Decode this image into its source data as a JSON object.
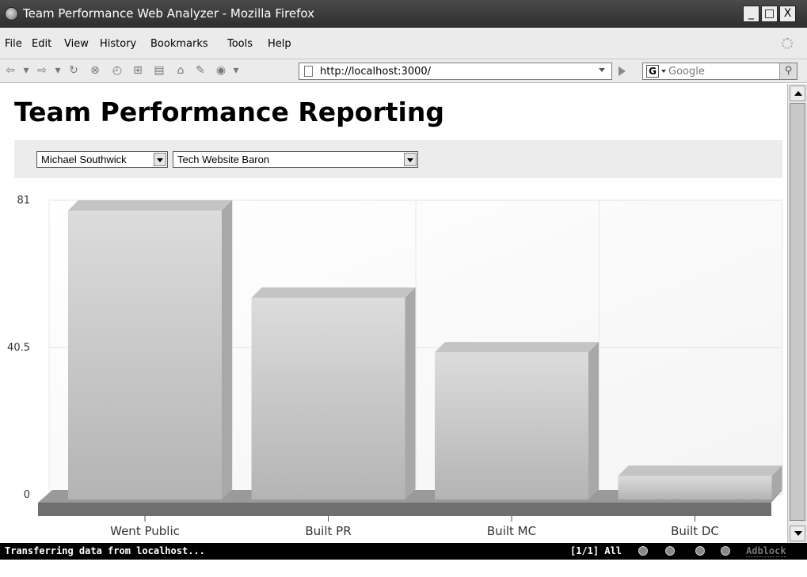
{
  "window": {
    "title": "Team Performance Web Analyzer - Mozilla Firefox",
    "min_label": "_",
    "max_label": "□",
    "close_label": "X"
  },
  "menu": {
    "items": [
      "File",
      "Edit",
      "View",
      "History",
      "Bookmarks",
      "Tools",
      "Help"
    ]
  },
  "toolbar": {
    "url": "http://localhost:3000/",
    "search_placeholder": "Google",
    "search_engine_letter": "G"
  },
  "page": {
    "title": "Team Performance Reporting",
    "user_select": "Michael Southwick",
    "project_select": "Tech Website Baron"
  },
  "chart_data": {
    "type": "bar",
    "style": "3d",
    "categories": [
      "Went Public",
      "Built PR",
      "Built MC",
      "Built DC"
    ],
    "values": [
      81,
      57,
      42,
      8
    ],
    "y_ticks": [
      "81",
      "40.5",
      "0"
    ],
    "ylim": [
      0,
      81
    ],
    "grid": true
  },
  "status": {
    "text": "Transferring data from localhost...",
    "tabs": "[1/1] All",
    "adblock": "Adblock"
  }
}
